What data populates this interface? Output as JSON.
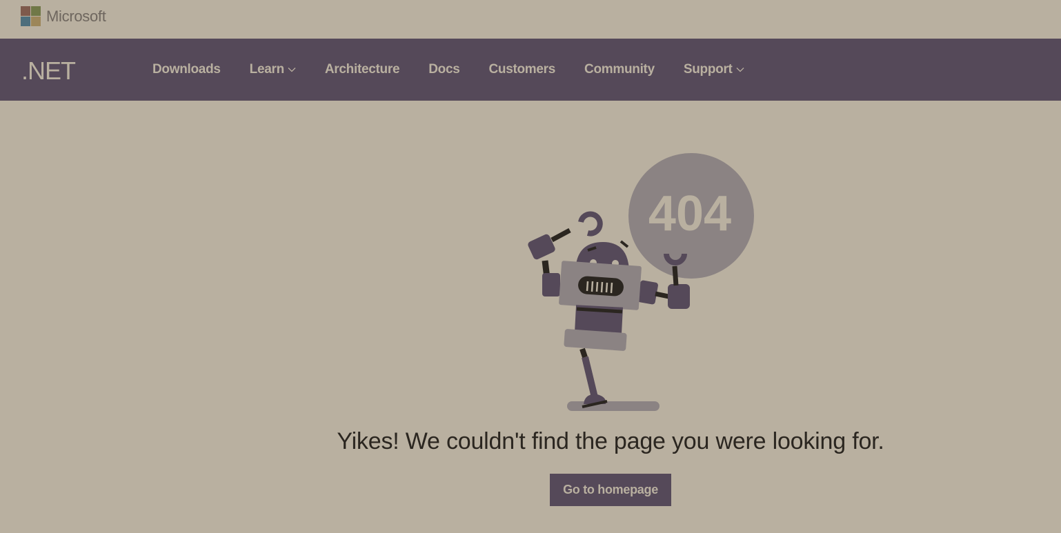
{
  "header": {
    "company_name": "Microsoft",
    "logo_colors": [
      "#7e5a4c",
      "#707847",
      "#4d6e7c",
      "#9c8659"
    ]
  },
  "nav": {
    "brand": ".NET",
    "items": [
      {
        "label": "Downloads",
        "has_dropdown": false
      },
      {
        "label": "Learn",
        "has_dropdown": true
      },
      {
        "label": "Architecture",
        "has_dropdown": false
      },
      {
        "label": "Docs",
        "has_dropdown": false
      },
      {
        "label": "Customers",
        "has_dropdown": false
      },
      {
        "label": "Community",
        "has_dropdown": false
      },
      {
        "label": "Support",
        "has_dropdown": true
      }
    ]
  },
  "error": {
    "code": "404",
    "message": "Yikes! We couldn't find the page you were looking for.",
    "button_label": "Go to homepage"
  },
  "colors": {
    "background": "#b9b0a0",
    "nav_background": "#554959",
    "accent": "#554959",
    "text": "#2b2620"
  }
}
